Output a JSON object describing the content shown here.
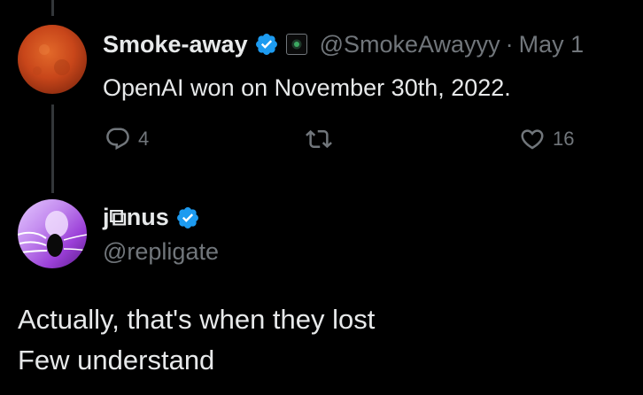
{
  "tweet1": {
    "author_name": "Smoke-away",
    "handle": "@SmokeAwayyy",
    "separator": "·",
    "date": "May 1",
    "text": "OpenAI won on November 30th, 2022.",
    "reply_count": "4",
    "like_count": "16"
  },
  "tweet2": {
    "author_name": "j⧉nus",
    "handle": "@repligate",
    "text_line1": "Actually, that's when they lost",
    "text_line2": "Few understand"
  },
  "colors": {
    "background": "#000000",
    "text": "#e7e9ea",
    "secondary": "#71767b",
    "verified": "#1d9bf0"
  }
}
